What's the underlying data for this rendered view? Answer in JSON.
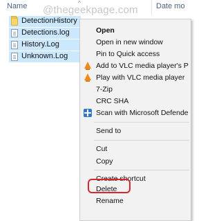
{
  "header": {
    "name_label": "Name",
    "date_label": "Date mo",
    "watermark": "@thegeekpage.com"
  },
  "files": [
    {
      "name": "DetectionHistory",
      "icon": "folder-icon"
    },
    {
      "name": "Detections.log",
      "icon": "document-icon"
    },
    {
      "name": "History.Log",
      "icon": "document-icon"
    },
    {
      "name": "Unknown.Log",
      "icon": "document-icon"
    }
  ],
  "menu": {
    "open": "Open",
    "open_new_window": "Open in new window",
    "pin_quick_access": "Pin to Quick access",
    "add_vlc_playlist": "Add to VLC media player's P",
    "play_vlc": "Play with VLC media player",
    "seven_zip": "7-Zip",
    "crc_sha": "CRC SHA",
    "scan_defender": "Scan with Microsoft Defende",
    "send_to": "Send to",
    "cut": "Cut",
    "copy": "Copy",
    "create_shortcut": "Create shortcut",
    "delete": "Delete",
    "rename": "Rename"
  },
  "colors": {
    "selection": "#cce8ff",
    "menu_background": "#f2f2f2",
    "highlight_border": "#d9262c",
    "vlc_orange": "#f08a1c",
    "defender_blue": "#2e79c7"
  }
}
